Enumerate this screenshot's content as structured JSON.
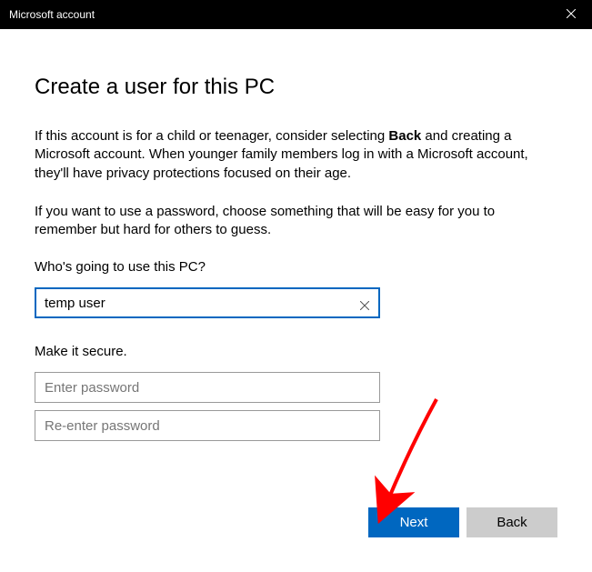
{
  "titlebar": {
    "title": "Microsoft account"
  },
  "page": {
    "heading": "Create a user for this PC",
    "intro_before_back": "If this account is for a child or teenager, consider selecting ",
    "intro_back_word": "Back",
    "intro_after_back": " and creating a Microsoft account. When younger family members log in with a Microsoft account, they'll have privacy protections focused on their age.",
    "password_hint": "If you want to use a password, choose something that will be easy for you to remember but hard for others to guess."
  },
  "form": {
    "username_label": "Who's going to use this PC?",
    "username_value": "temp user",
    "secure_label": "Make it secure.",
    "password_placeholder": "Enter password",
    "password_confirm_placeholder": "Re-enter password"
  },
  "buttons": {
    "next": "Next",
    "back": "Back"
  }
}
